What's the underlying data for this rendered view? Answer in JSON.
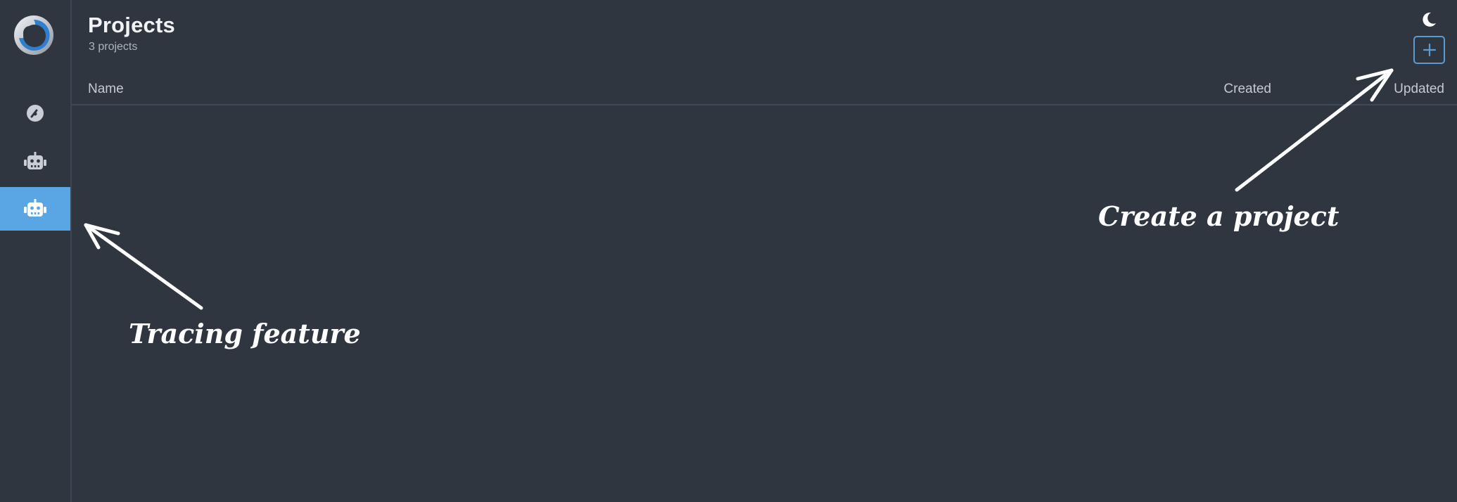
{
  "header": {
    "title": "Projects",
    "subtitle": "3 projects"
  },
  "table": {
    "columns": [
      "Name",
      "Created",
      "Updated"
    ]
  },
  "sidebar": {
    "items": [
      {
        "icon": "dashboard-gauge-icon",
        "active": false
      },
      {
        "icon": "robot-icon",
        "active": false
      },
      {
        "icon": "robot-icon",
        "active": true
      }
    ]
  },
  "actions": {
    "add_icon": "plus-icon",
    "theme_icon": "moon-icon"
  },
  "annotations": {
    "tracing": "Tracing feature",
    "create": "Create a project"
  },
  "colors": {
    "background": "#303640",
    "active_nav": "#5aa5e3",
    "accent": "#5a9bd4",
    "text": "#f1f3f5"
  }
}
